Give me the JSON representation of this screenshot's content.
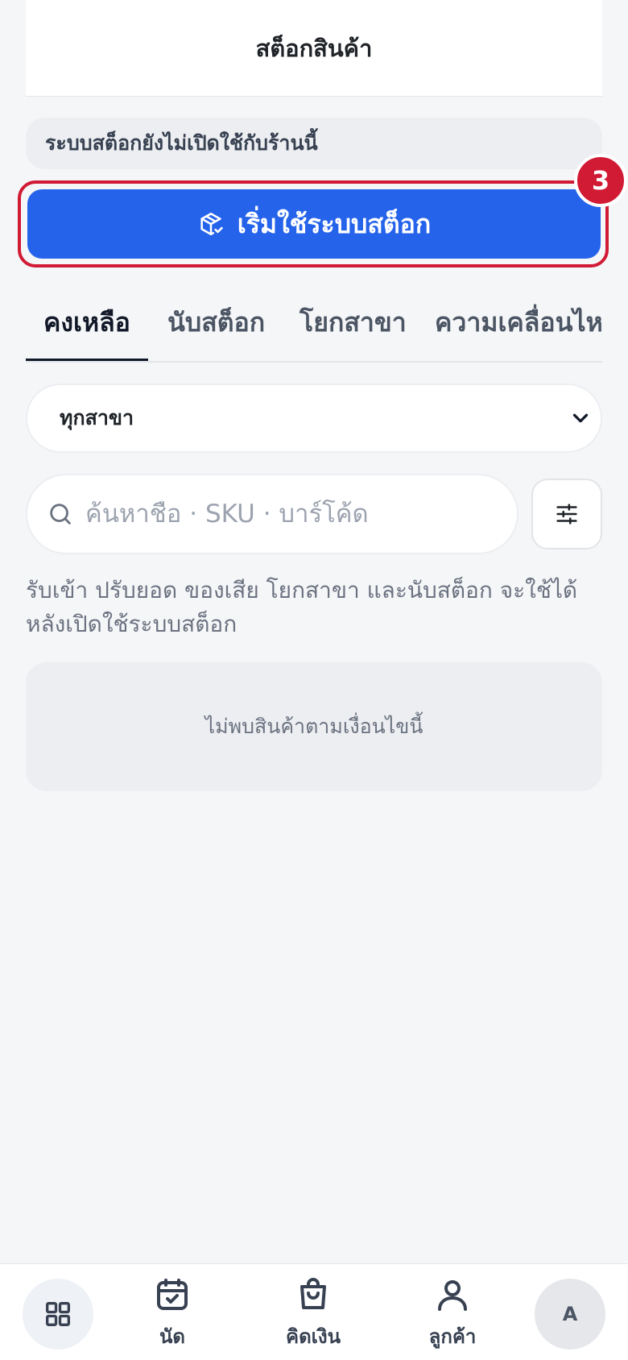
{
  "header": {
    "title": "สต็อกสินค้า"
  },
  "notice": {
    "text": "ระบบสต็อกยังไม่เปิดใช้กับร้านนี้"
  },
  "start_button": {
    "label": "เริ่มใช้ระบบสต็อก",
    "icon": "package-check-icon"
  },
  "step_badge": {
    "number": "3"
  },
  "tabs": [
    {
      "label": "คงเหลือ",
      "active": true
    },
    {
      "label": "นับสต็อก",
      "active": false
    },
    {
      "label": "โยกสาขา",
      "active": false
    },
    {
      "label": "ความเคลื่อนไหว",
      "active": false
    }
  ],
  "branch_select": {
    "selected": "ทุกสาขา",
    "icon": "chevron-down-icon"
  },
  "search": {
    "placeholder": "ค้นหาชื่อ · SKU · บาร์โค้ด",
    "value": "",
    "icon": "search-icon"
  },
  "filter": {
    "icon": "sliders-icon"
  },
  "helper_text": "รับเข้า ปรับยอด ของเสีย โยกสาขา และนับสต็อก จะใช้ได้หลังเปิดใช้ระบบสต็อก",
  "empty_state": {
    "text": "ไม่พบสินค้าตามเงื่อนไขนี้"
  },
  "bottom_nav": {
    "home_icon": "grid-icon",
    "items": [
      {
        "label": "นัด",
        "icon": "calendar-check-icon"
      },
      {
        "label": "คิดเงิน",
        "icon": "shopping-bag-icon"
      },
      {
        "label": "ลูกค้า",
        "icon": "user-icon"
      }
    ],
    "avatar_initial": "A"
  },
  "colors": {
    "primary": "#2563eb",
    "highlight": "#d11a34",
    "background": "#f5f6f8"
  }
}
